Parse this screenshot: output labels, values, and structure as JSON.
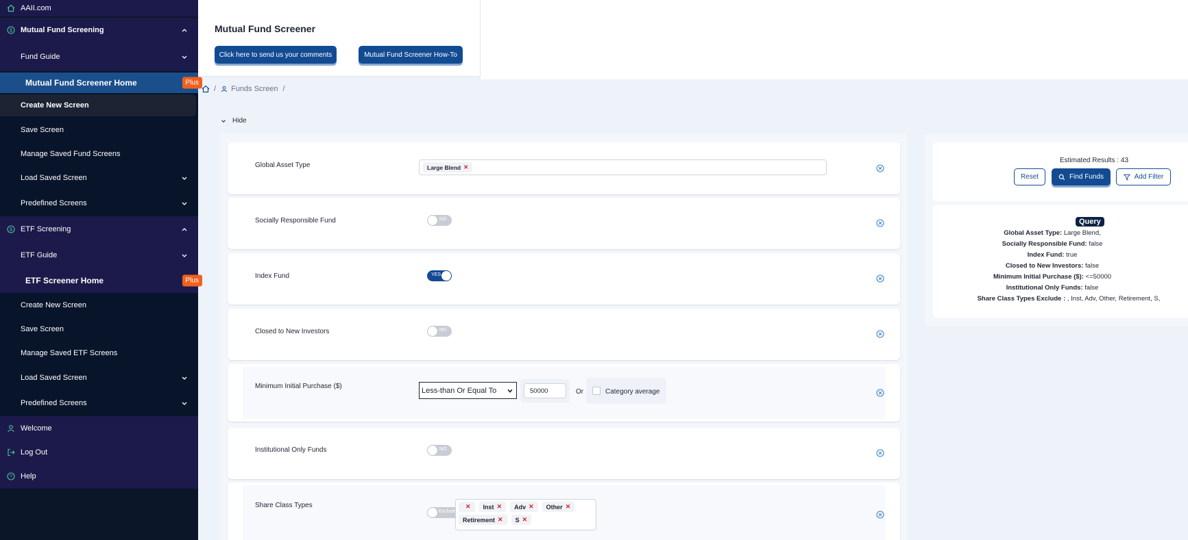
{
  "sidebar": {
    "items": [
      {
        "label": "AAII.com",
        "icon": "home-icon"
      },
      {
        "label": "Mutual Fund Screening",
        "icon": "dollar-icon"
      },
      {
        "label": "Fund Guide"
      },
      {
        "label": "Mutual Fund Screener Home",
        "badge": "Plus"
      },
      {
        "label": "Create New Screen"
      },
      {
        "label": "Save Screen"
      },
      {
        "label": "Manage Saved Fund Screens"
      },
      {
        "label": "Load Saved Screen"
      },
      {
        "label": "Predefined Screens"
      },
      {
        "label": "ETF Screening",
        "icon": "dollar-icon"
      },
      {
        "label": "ETF Guide"
      },
      {
        "label": "ETF Screener Home",
        "badge": "Plus"
      },
      {
        "label": "Create New Screen"
      },
      {
        "label": "Save Screen"
      },
      {
        "label": "Manage Saved ETF Screens"
      },
      {
        "label": "Load Saved Screen"
      },
      {
        "label": "Predefined Screens"
      },
      {
        "label": "Welcome",
        "icon": "user-icon"
      },
      {
        "label": "Log Out",
        "icon": "logout-icon"
      },
      {
        "label": "Help",
        "icon": "help-icon"
      }
    ]
  },
  "header": {
    "title": "Mutual Fund Screener",
    "comments_button": "Click here to send us your comments",
    "howto_button": "Mutual Fund Screener How-To"
  },
  "breadcrumb": {
    "sep": "/",
    "funds_screen": "Funds Screen"
  },
  "hide_label": "Hide",
  "filters": {
    "global_asset_type": {
      "label": "Global Asset Type",
      "tags": [
        "Large Blend"
      ]
    },
    "socially_responsible": {
      "label": "Socially Responsible Fund",
      "toggle": "NO"
    },
    "index_fund": {
      "label": "Index Fund",
      "toggle": "YES"
    },
    "closed_to_new": {
      "label": "Closed to New Investors",
      "toggle": "NO"
    },
    "min_initial_purchase": {
      "label": "Minimum Initial Purchase ($)",
      "operator": "Less-than Or Equal To",
      "value": "50000",
      "or_label": "Or",
      "category_average_label": "Category average"
    },
    "institutional_only": {
      "label": "Institutional Only Funds",
      "toggle": "NO"
    },
    "share_class_types": {
      "label": "Share Class Types",
      "toggle": "Exclude",
      "tags_row1": [
        "",
        "Inst",
        "Adv",
        "Other"
      ],
      "tags_row2": [
        "Retirement",
        "S"
      ]
    }
  },
  "results": {
    "estimated_label": "Estimated Results : 43",
    "reset": "Reset",
    "find_funds": "Find Funds",
    "add_filter": "Add Filter"
  },
  "query": {
    "title": "Query",
    "lines": [
      {
        "key": "Global Asset Type:",
        "value": " Large Blend,"
      },
      {
        "key": "Socially Responsible Fund:",
        "value": " false"
      },
      {
        "key": "Index Fund:",
        "value": " true"
      },
      {
        "key": "Closed to New Investors:",
        "value": " false"
      },
      {
        "key": "Minimum Initial Purchase ($):",
        "value": " <=50000"
      },
      {
        "key": "Institutional Only Funds:",
        "value": " false"
      },
      {
        "key": "Share Class Types Exclude :",
        "value": " , Inst, Adv, Other, Retirement, S,"
      }
    ]
  },
  "colors": {
    "sidebar_bg": "#0b1628",
    "sidebar_group": "#1c1a4a",
    "active_item": "#1a4f8c",
    "accent_blue": "#134b93",
    "plus_badge": "#f0611f",
    "remove_red": "#d0232c"
  }
}
